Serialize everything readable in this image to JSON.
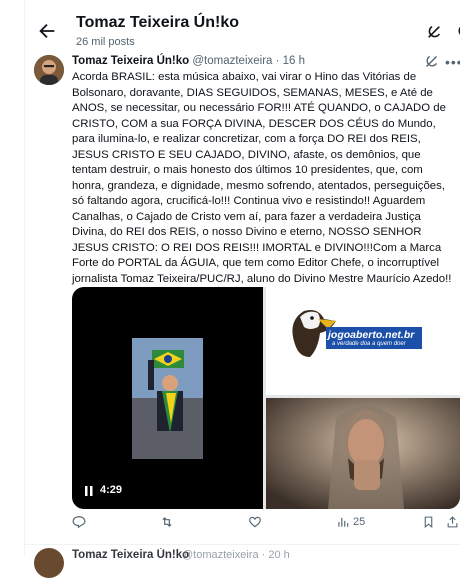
{
  "header": {
    "title": "Tomaz Teixeira Ún!ko",
    "subtitle": "26 mil posts"
  },
  "tweet": {
    "author_name": "Tomaz Teixeira Ún!ko",
    "author_handle": "@tomazteixeira",
    "separator": " · ",
    "time": "16 h",
    "text": "Acorda BRASIL: esta música abaixo, vai virar o Hino das Vitórias de Bolsonaro, doravante, DIAS SEGUIDOS, SEMANAS, MESES, e Até de ANOS, se necessitar, ou necessário FOR!!! ATÉ QUANDO, o CAJADO de CRISTO, COM  a sua FORÇA DIVINA, DESCER  DOS CÉUS do Mundo, para ilumina-lo, e realizar concretizar, com a força DO REI dos REIS, JESUS CRISTO E SEU CAJADO, DIVINO, afaste, os demônios, que tentam destruir, o mais honesto dos últimos 10 presidentes, que,  com honra, grandeza, e dignidade, mesmo sofrendo, atentados,  perseguições, só faltando agora, crucificá-lo!!! Continua vivo e resistindo!! Aguardem Canalhas, o Cajado de Cristo vem aí, para fazer a verdadeira Justiça Divina, do REI dos REIS, o nosso Divino e eterno, NOSSO SENHOR JESUS CRISTO: O REI DOS REIS!!! IMORTAL e DIVINO!!!Com a Marca Forte do PORTAL da ÁGUIA, que tem como Editor Chefe, o incorruptível jornalista Tomaz Teixeira/PUC/RJ, aluno do Divino Mestre Maurício Azedo!!",
    "video_duration": "4:29",
    "logo_text": "jogoaberto.net.br",
    "logo_tagline": "a verdade doa a quem doer",
    "views": "25"
  },
  "next_post": {
    "author_name": "Tomaz Teixeira Ún!ko",
    "rest": "@tomazteixeira · 20 h"
  },
  "colors": {
    "text": "#0f1419",
    "muted": "#536471",
    "link_blue": "#1d9bf0"
  }
}
